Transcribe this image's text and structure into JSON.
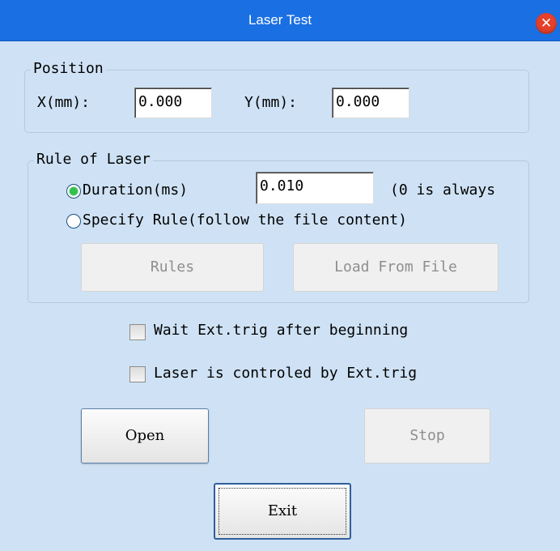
{
  "window": {
    "title": "Laser Test",
    "close_glyph": "✕"
  },
  "position": {
    "legend": "Position",
    "x_label": "X(mm):",
    "x_value": "0.000",
    "y_label": "Y(mm):",
    "y_value": "0.000"
  },
  "rule": {
    "legend": "Rule of Laser",
    "duration_label": "Duration(ms)",
    "duration_value": "0.010",
    "duration_note": "(0 is always",
    "specify_label": "Specify Rule(follow the file content)",
    "selected": "duration",
    "rules_button": "Rules",
    "load_button": "Load From File"
  },
  "options": {
    "wait_label": "Wait Ext.trig after beginning",
    "wait_checked": false,
    "controlled_label": "Laser is controled by Ext.trig",
    "controlled_checked": false
  },
  "actions": {
    "open": "Open",
    "stop": "Stop",
    "exit": "Exit"
  },
  "colors": {
    "titlebar": "#1a6fe3",
    "background": "#cfe2f5",
    "close": "#e5402a",
    "radio_selected": "#2fc24d"
  }
}
